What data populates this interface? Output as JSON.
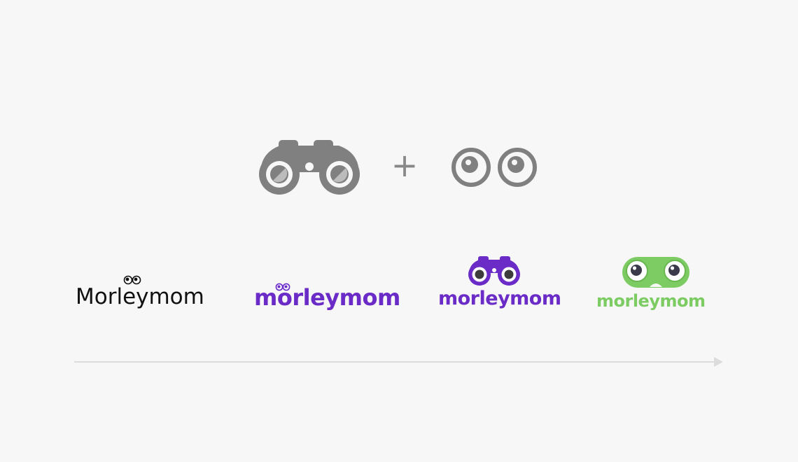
{
  "colors": {
    "background": "#f7f7f7",
    "icon_gray": "#808080",
    "logo_black": "#111111",
    "purple": "#6a2bc7",
    "green": "#7ccb63",
    "arrow": "#dcdcdc"
  },
  "concept": {
    "left_icon": "binoculars-icon",
    "operator": "+",
    "right_icon": "googly-eyes-icon"
  },
  "evolution": [
    {
      "text": "Morleymom",
      "color": "#111111",
      "icon": "eyes-icon"
    },
    {
      "text": "morleymom",
      "color": "#6a2bc7",
      "icon": "eyes-icon"
    },
    {
      "text": "morleymom",
      "color": "#6a2bc7",
      "icon": "binoculars-icon"
    },
    {
      "text": "morleymom",
      "color": "#7ccb63",
      "icon": "goggles-icon"
    }
  ]
}
